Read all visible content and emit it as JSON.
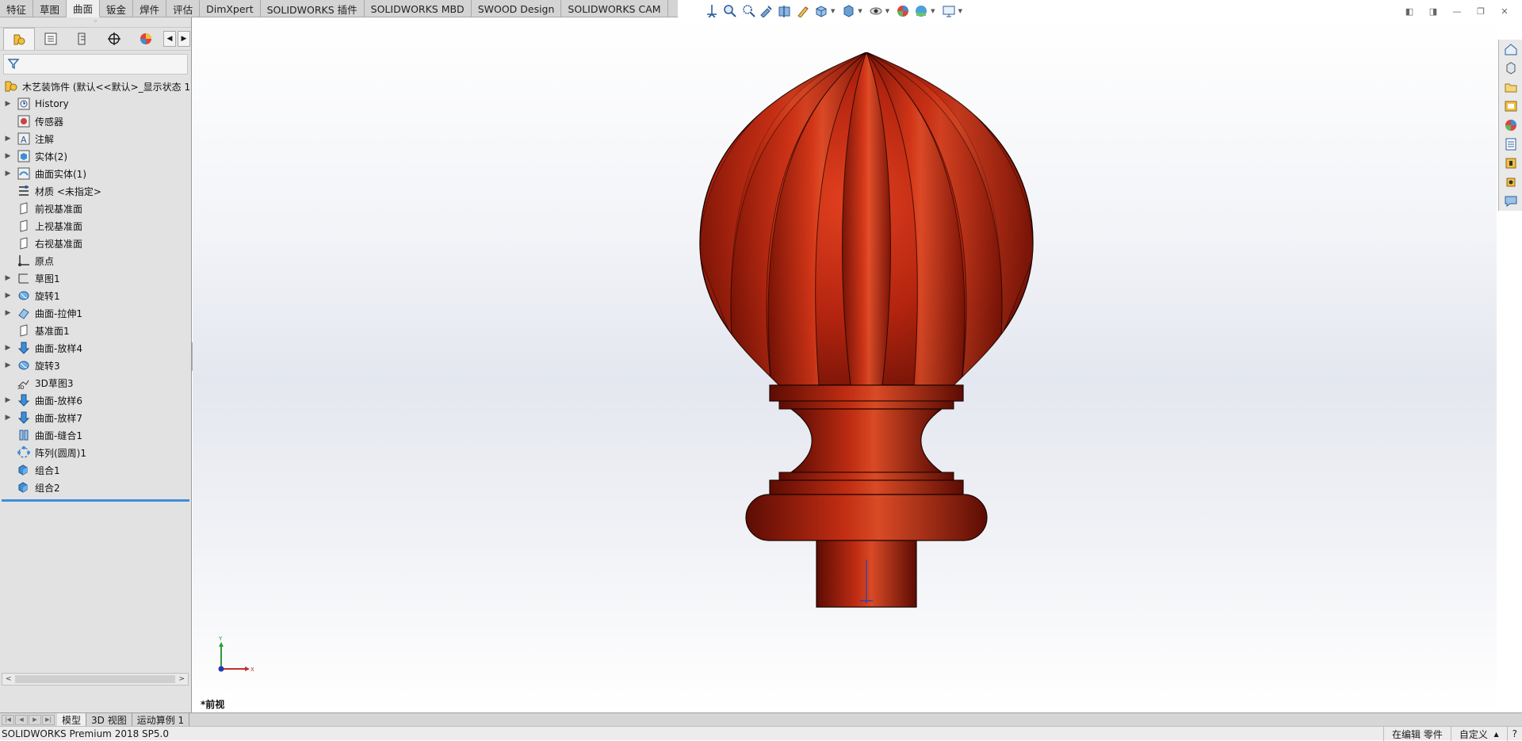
{
  "command_tabs": [
    "特征",
    "草图",
    "曲面",
    "钣金",
    "焊件",
    "评估",
    "DimXpert",
    "SOLIDWORKS 插件",
    "SOLIDWORKS MBD",
    "SWOOD Design",
    "SOLIDWORKS CAM"
  ],
  "active_command_tab": "曲面",
  "feature_tree": {
    "root": "木艺装饰件  (默认<<默认>_显示状态 1",
    "items": [
      {
        "label": "History",
        "expandable": true,
        "icon": "history-icon"
      },
      {
        "label": "传感器",
        "expandable": false,
        "icon": "sensor-icon"
      },
      {
        "label": "注解",
        "expandable": true,
        "icon": "annotation-icon"
      },
      {
        "label": "实体(2)",
        "expandable": true,
        "icon": "solid-bodies-icon"
      },
      {
        "label": "曲面实体(1)",
        "expandable": true,
        "icon": "surface-bodies-icon"
      },
      {
        "label": "材质 <未指定>",
        "expandable": false,
        "icon": "material-icon"
      },
      {
        "label": "前视基准面",
        "expandable": false,
        "icon": "plane-icon"
      },
      {
        "label": "上视基准面",
        "expandable": false,
        "icon": "plane-icon"
      },
      {
        "label": "右视基准面",
        "expandable": false,
        "icon": "plane-icon"
      },
      {
        "label": "原点",
        "expandable": false,
        "icon": "origin-icon"
      },
      {
        "label": "草图1",
        "expandable": true,
        "icon": "sketch-icon"
      },
      {
        "label": "旋转1",
        "expandable": true,
        "icon": "revolve-icon"
      },
      {
        "label": "曲面-拉伸1",
        "expandable": true,
        "icon": "surface-extrude-icon"
      },
      {
        "label": "基准面1",
        "expandable": false,
        "icon": "plane-icon"
      },
      {
        "label": "曲面-放样4",
        "expandable": true,
        "icon": "surface-loft-icon"
      },
      {
        "label": "旋转3",
        "expandable": true,
        "icon": "revolve-icon"
      },
      {
        "label": "3D草图3",
        "expandable": false,
        "icon": "sketch3d-icon"
      },
      {
        "label": "曲面-放样6",
        "expandable": true,
        "icon": "surface-loft-icon"
      },
      {
        "label": "曲面-放样7",
        "expandable": true,
        "icon": "surface-loft-icon"
      },
      {
        "label": "曲面-缝合1",
        "expandable": false,
        "icon": "knit-icon"
      },
      {
        "label": "阵列(圆周)1",
        "expandable": false,
        "icon": "circular-pattern-icon"
      },
      {
        "label": "组合1",
        "expandable": false,
        "icon": "combine-icon"
      },
      {
        "label": "组合2",
        "expandable": false,
        "icon": "combine-icon"
      }
    ]
  },
  "view_name": "*前视",
  "triad": {
    "x_label": "X",
    "y_label": "Y"
  },
  "bottom_tabs": [
    "模型",
    "3D 视图",
    "运动算例 1"
  ],
  "active_bottom_tab": "模型",
  "status": {
    "product": "SOLIDWORKS Premium 2018 SP5.0",
    "editing": "在编辑 零件",
    "units": "自定义"
  },
  "colors": {
    "wood": "#b3240f",
    "tree_rollback": "#3b8fd8"
  }
}
